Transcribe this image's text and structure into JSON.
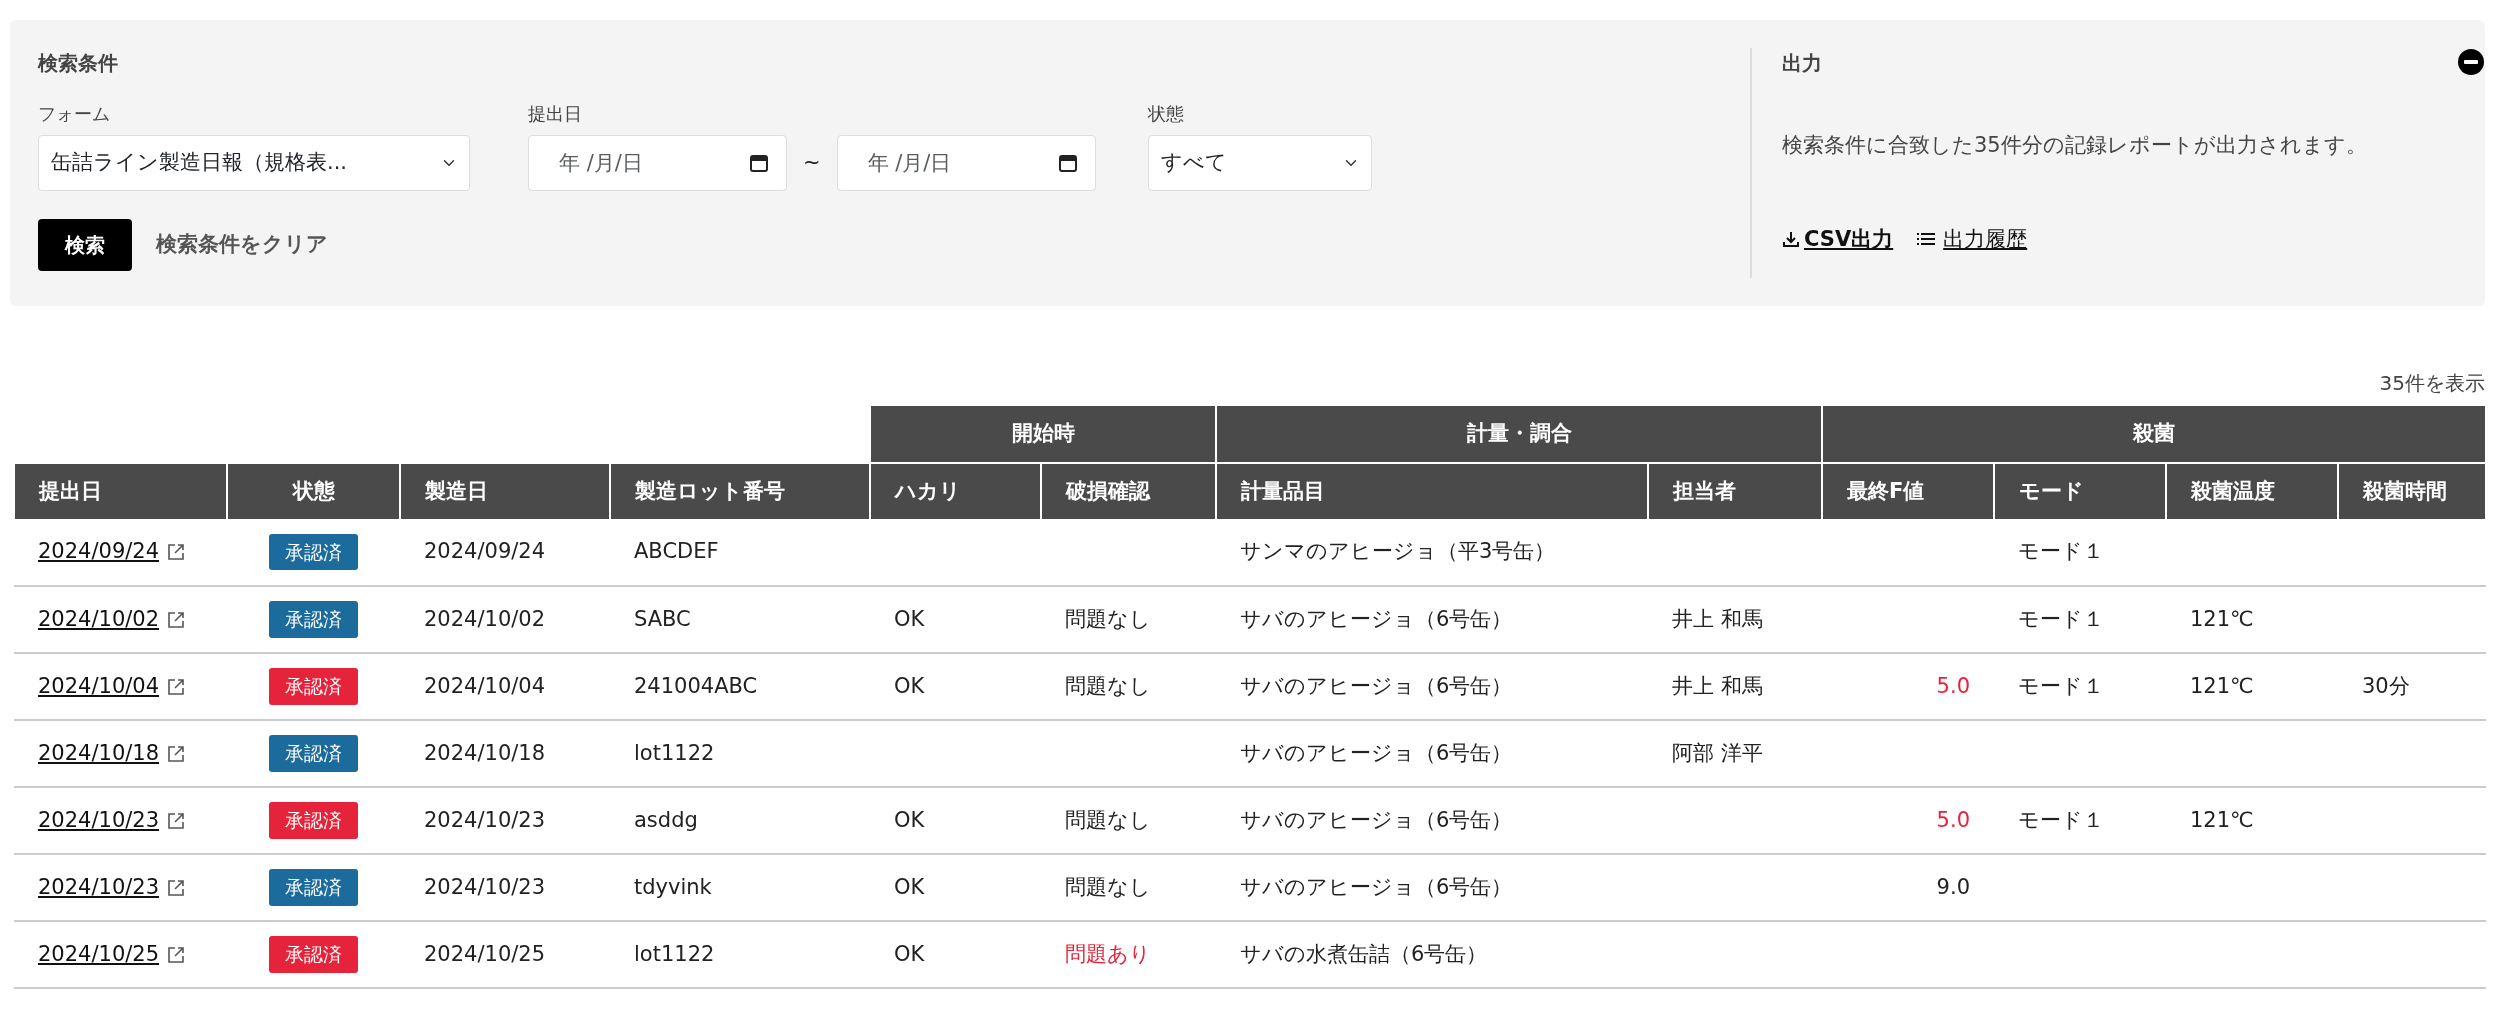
{
  "search": {
    "title": "検索条件",
    "form_field": {
      "label": "フォーム",
      "value": "缶詰ライン製造日報（規格表..."
    },
    "date_field": {
      "label": "提出日",
      "from": {
        "placeholder": "年 /月/日"
      },
      "separator": "~",
      "to": {
        "placeholder": "年 /月/日"
      }
    },
    "status_field": {
      "label": "状態",
      "value": "すべて"
    },
    "search_button": "検索",
    "clear_link": "検索条件をクリア"
  },
  "output": {
    "title": "出力",
    "description": "検索条件に合致した35件分の記録レポートが出力されます。",
    "csv_link": "CSV出力",
    "history_link": "出力履歴"
  },
  "result_count": "35件を表示",
  "table": {
    "column_groups": [
      {
        "columns": [
          "提出日",
          "状態",
          "製造日",
          "製造ロット番号"
        ]
      },
      {
        "label": "開始時",
        "columns": [
          "ハカリ",
          "破損確認"
        ]
      },
      {
        "label": "計量・調合",
        "columns": [
          "計量品目",
          "担当者"
        ]
      },
      {
        "label": "殺菌",
        "columns": [
          "最終F値",
          "モード",
          "殺菌温度",
          "殺菌時間"
        ]
      }
    ],
    "rows": [
      {
        "submitted": "2024/09/24",
        "status": {
          "label": "承認済",
          "color": "#1b6b9d"
        },
        "cells": [
          {
            "text": "2024/09/24",
            "alert": false
          },
          {
            "text": "ABCDEF",
            "alert": false
          },
          null,
          null,
          {
            "text": "サンマのアヒージョ（平3号缶）",
            "alert": false
          },
          null,
          null,
          {
            "text": "モード１",
            "alert": false
          },
          null,
          null
        ]
      },
      {
        "submitted": "2024/10/02",
        "status": {
          "label": "承認済",
          "color": "#1b6b9d"
        },
        "cells": [
          {
            "text": "2024/10/02",
            "alert": false
          },
          {
            "text": "SABC",
            "alert": false
          },
          {
            "text": "OK",
            "alert": false
          },
          {
            "text": "問題なし",
            "alert": false
          },
          {
            "text": "サバのアヒージョ（6号缶）",
            "alert": false
          },
          {
            "text": "井上 和馬",
            "alert": false
          },
          null,
          {
            "text": "モード１",
            "alert": false
          },
          {
            "text": "121℃",
            "alert": false
          },
          null
        ]
      },
      {
        "submitted": "2024/10/04",
        "status": {
          "label": "承認済",
          "color": "#e5233b"
        },
        "cells": [
          {
            "text": "2024/10/04",
            "alert": false
          },
          {
            "text": "241004ABC",
            "alert": false
          },
          {
            "text": "OK",
            "alert": false
          },
          {
            "text": "問題なし",
            "alert": false
          },
          {
            "text": "サバのアヒージョ（6号缶）",
            "alert": false
          },
          {
            "text": "井上 和馬",
            "alert": false
          },
          {
            "text": "5.0",
            "alert": true
          },
          {
            "text": "モード１",
            "alert": false
          },
          {
            "text": "121℃",
            "alert": false
          },
          {
            "text": "30分",
            "alert": false
          }
        ]
      },
      {
        "submitted": "2024/10/18",
        "status": {
          "label": "承認済",
          "color": "#1b6b9d"
        },
        "cells": [
          {
            "text": "2024/10/18",
            "alert": false
          },
          {
            "text": "lot1122",
            "alert": false
          },
          null,
          null,
          {
            "text": "サバのアヒージョ（6号缶）",
            "alert": false
          },
          {
            "text": "阿部 洋平",
            "alert": false
          },
          null,
          null,
          null,
          null
        ]
      },
      {
        "submitted": "2024/10/23",
        "status": {
          "label": "承認済",
          "color": "#e5233b"
        },
        "cells": [
          {
            "text": "2024/10/23",
            "alert": false
          },
          {
            "text": "asddg",
            "alert": false
          },
          {
            "text": "OK",
            "alert": false
          },
          {
            "text": "問題なし",
            "alert": false
          },
          {
            "text": "サバのアヒージョ（6号缶）",
            "alert": false
          },
          null,
          {
            "text": "5.0",
            "alert": true
          },
          {
            "text": "モード１",
            "alert": false
          },
          {
            "text": "121℃",
            "alert": false
          },
          null
        ]
      },
      {
        "submitted": "2024/10/23",
        "status": {
          "label": "承認済",
          "color": "#1b6b9d"
        },
        "cells": [
          {
            "text": "2024/10/23",
            "alert": false
          },
          {
            "text": "tdyvink",
            "alert": false
          },
          {
            "text": "OK",
            "alert": false
          },
          {
            "text": "問題なし",
            "alert": false
          },
          {
            "text": "サバのアヒージョ（6号缶）",
            "alert": false
          },
          null,
          {
            "text": "9.0",
            "alert": false
          },
          null,
          null,
          null
        ]
      },
      {
        "submitted": "2024/10/25",
        "status": {
          "label": "承認済",
          "color": "#e5233b"
        },
        "cells": [
          {
            "text": "2024/10/25",
            "alert": false
          },
          {
            "text": "lot1122",
            "alert": false
          },
          {
            "text": "OK",
            "alert": false
          },
          {
            "text": "問題あり",
            "alert": true
          },
          {
            "text": "サバの水煮缶詰（6号缶）",
            "alert": false
          },
          null,
          null,
          null,
          null,
          null
        ]
      }
    ]
  }
}
